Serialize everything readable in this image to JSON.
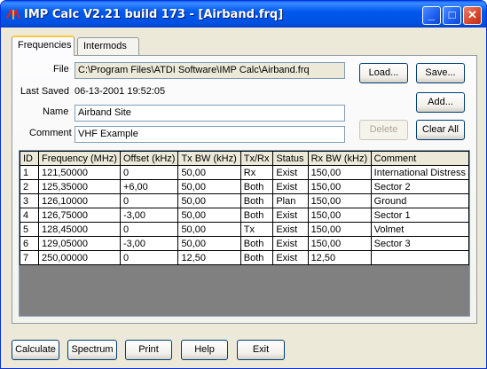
{
  "window": {
    "title": "IMP Calc V2.21 build 173 - [Airband.frq]"
  },
  "tabs": [
    {
      "label": "Frequencies",
      "active": true
    },
    {
      "label": "Intermods",
      "active": false
    }
  ],
  "form": {
    "file_label": "File",
    "file_value": "C:\\Program Files\\ATDI Software\\IMP Calc\\Airband.frq",
    "last_saved_label": "Last Saved",
    "last_saved_value": "06-13-2001 19:52:05",
    "name_label": "Name",
    "name_value": "Airband Site",
    "comment_label": "Comment",
    "comment_value": "VHF Example"
  },
  "buttons": {
    "load": "Load...",
    "save": "Save...",
    "add": "Add...",
    "delete": "Delete",
    "clear_all": "Clear All",
    "calculate": "Calculate",
    "spectrum": "Spectrum",
    "print": "Print",
    "help": "Help",
    "exit": "Exit"
  },
  "table": {
    "columns": [
      "ID",
      "Frequency (MHz)",
      "Offset (kHz)",
      "Tx BW (kHz)",
      "Tx/Rx",
      "Status",
      "Rx BW (kHz)",
      "Comment"
    ],
    "rows": [
      [
        "1",
        "121,50000",
        "0",
        "50,00",
        "Rx",
        "Exist",
        "150,00",
        "International Distress"
      ],
      [
        "2",
        "125,35000",
        "+6,00",
        "50,00",
        "Both",
        "Exist",
        "150,00",
        "Sector 2"
      ],
      [
        "3",
        "126,10000",
        "0",
        "50,00",
        "Both",
        "Plan",
        "150,00",
        "Ground"
      ],
      [
        "4",
        "126,75000",
        "-3,00",
        "50,00",
        "Both",
        "Exist",
        "150,00",
        "Sector 1"
      ],
      [
        "5",
        "128,45000",
        "0",
        "50,00",
        "Tx",
        "Exist",
        "150,00",
        "Volmet"
      ],
      [
        "6",
        "129,05000",
        "-3,00",
        "50,00",
        "Both",
        "Exist",
        "150,00",
        "Sector 3"
      ],
      [
        "7",
        "250,00000",
        "0",
        "12,50",
        "Both",
        "Exist",
        "12,50",
        ""
      ]
    ]
  },
  "icons": {
    "app": "antenna-icon",
    "minimize": "minimize-icon",
    "maximize": "maximize-icon",
    "close": "close-icon"
  },
  "colors": {
    "titlebar": "#0058ee",
    "close_button": "#d6452a",
    "grid_empty": "#808080",
    "tab_highlight": "#ffc83c"
  }
}
